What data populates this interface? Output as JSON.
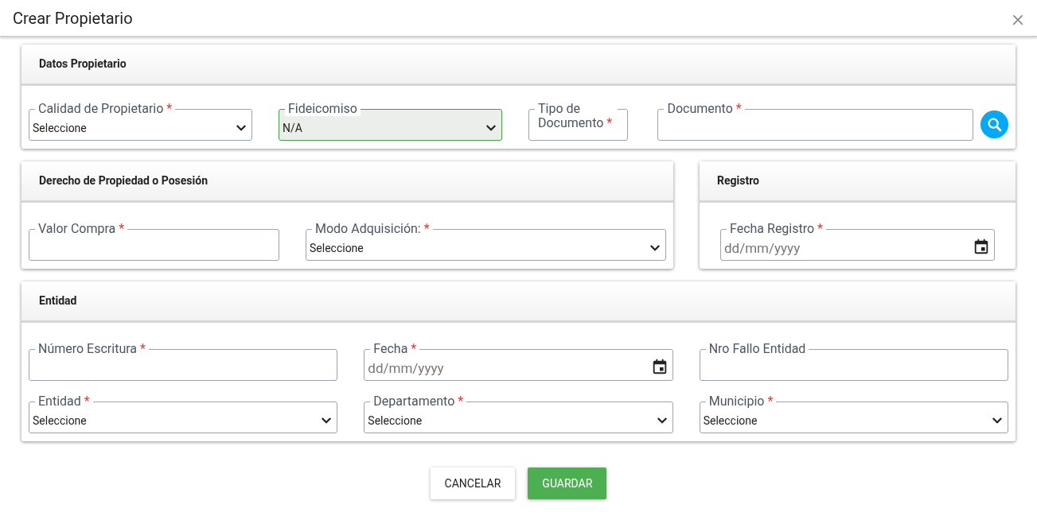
{
  "dialog": {
    "title": "Crear Propietario",
    "close": "×"
  },
  "sections": [
    {
      "title": "Datos Propietario",
      "fields": [
        {
          "kind": "select",
          "label": "Calidad de Propietario",
          "required_mark": "*",
          "value": "Seleccione",
          "valid": false
        },
        {
          "kind": "select",
          "label": "Fideicomiso",
          "value": "N/A",
          "valid": true
        },
        {
          "kind": "narrow",
          "label": "Tipo de Documento",
          "required_mark": "*",
          "valid": false
        },
        {
          "kind": "search",
          "label": "Documento",
          "required_mark": "*",
          "valid": false
        }
      ]
    },
    {
      "title": "Derecho de Propiedad o Posesión",
      "fields": [
        {
          "kind": "text",
          "label": "Valor Compra",
          "required_mark": "*",
          "valid": false
        },
        {
          "kind": "select",
          "label": "Modo Adquisición:",
          "required_mark": "*",
          "value": "Seleccione",
          "valid": false
        }
      ]
    },
    {
      "title": "Registro",
      "fields": [
        {
          "kind": "date",
          "label": "Fecha Registro",
          "required_mark": "*",
          "placeholder": "dd/mm/yyyy",
          "valid": false
        }
      ]
    },
    {
      "title": "Entidad",
      "fields": [
        {
          "kind": "text",
          "label": "Número Escritura",
          "required_mark": "*",
          "valid": false
        },
        {
          "kind": "date",
          "label": "Fecha",
          "required_mark": "*",
          "placeholder": "dd/mm/yyyy",
          "valid": false
        },
        {
          "kind": "text",
          "label": "Nro Fallo Entidad",
          "valid": false
        },
        {
          "kind": "select",
          "label": "Entidad",
          "required_mark": "*",
          "value": "Seleccione",
          "valid": false
        },
        {
          "kind": "select",
          "label": "Departamento",
          "required_mark": "*",
          "value": "Seleccione",
          "valid": false
        },
        {
          "kind": "select",
          "label": "Municipio",
          "required_mark": "*",
          "value": "Seleccione",
          "valid": false
        }
      ]
    }
  ],
  "buttons": [
    {
      "label": "CANCELAR",
      "kind": "secondary"
    },
    {
      "label": "GUARDAR",
      "kind": "primary"
    }
  ]
}
